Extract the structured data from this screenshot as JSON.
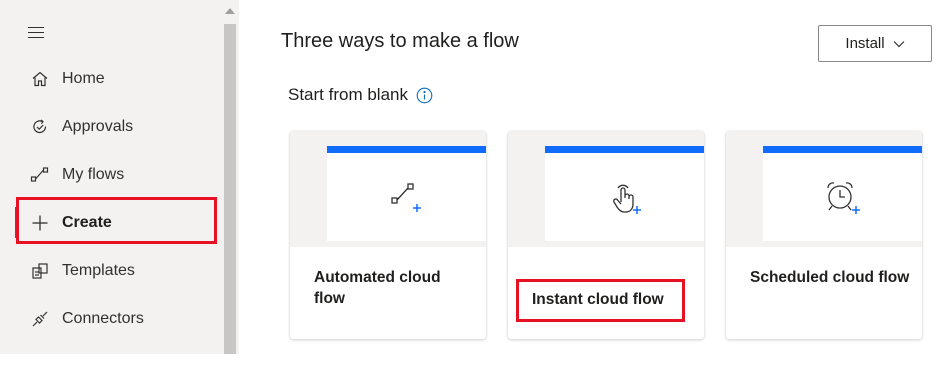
{
  "sidebar": {
    "items": [
      {
        "label": "Home",
        "icon": "home-icon"
      },
      {
        "label": "Approvals",
        "icon": "approvals-icon"
      },
      {
        "label": "My flows",
        "icon": "my-flows-icon"
      },
      {
        "label": "Create",
        "icon": "plus-icon",
        "active": true
      },
      {
        "label": "Templates",
        "icon": "templates-icon"
      },
      {
        "label": "Connectors",
        "icon": "connectors-icon"
      }
    ]
  },
  "main": {
    "title": "Three ways to make a flow",
    "install_label": "Install",
    "section_title": "Start from blank",
    "cards": [
      {
        "label": "Automated cloud flow",
        "icon": "automated-flow-icon"
      },
      {
        "label": "Instant cloud flow",
        "icon": "touch-hand-icon"
      },
      {
        "label": "Scheduled cloud flow",
        "icon": "alarm-clock-icon"
      }
    ]
  },
  "colors": {
    "accent_blue": "#0f6cfd",
    "highlight_red": "#e81123",
    "sidebar_bg": "#f3f2f1"
  }
}
